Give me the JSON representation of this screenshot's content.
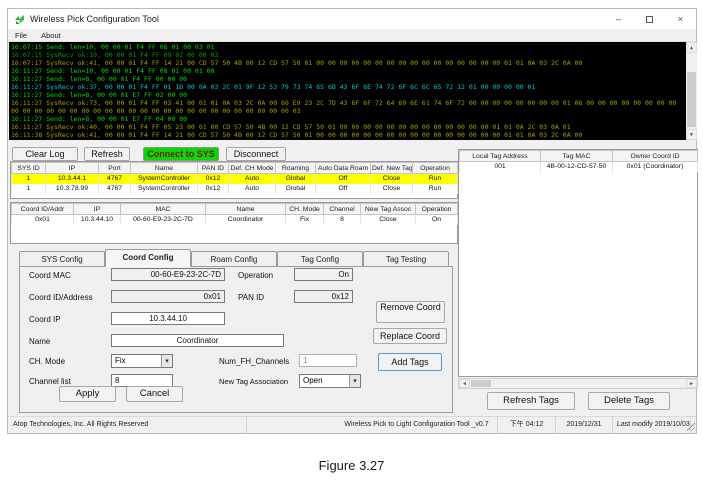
{
  "palette": {
    "log_send_green": "#00dc00",
    "log_recv_green": "#00a000",
    "log_recv_olive": "#a0a000",
    "log_recv_cyan": "#00c8c8",
    "selected_row_yellow": "#ffff00",
    "connect_button_green": "#0ad50a",
    "connect_button_text": "#7a2000"
  },
  "window": {
    "title": "Wireless Pick Configuration Tool",
    "minimize_glyph": "–",
    "close_glyph": "×"
  },
  "menu": {
    "file": "File",
    "about": "About"
  },
  "log": {
    "lines": [
      {
        "color": "g",
        "text": "16:07:15 Send: len=10, 00 00 01 F4 FF 08 01 00 03 01"
      },
      {
        "color": "dg",
        "text": "16:07:15 SysRecv ok:10, 00 00 01 F4 FF 09 02 00 00 03"
      },
      {
        "color": "ol",
        "text": "16:07:17 SysRecv ok:41, 00 00 01 F4 FF 14 21 00 CD 57 50 4B 00 12 CD 57 50 01 00 00 00 00 00 00 00 00 00 00 00 00 00 00 00 00 01 01 0A 03 2C 0A 00"
      },
      {
        "color": "g",
        "text": "16:11:27 Send: len=10, 00 00 01 F4 FF 08 01 00 01 00"
      },
      {
        "color": "g",
        "text": "16:11:27 Send: len=8, 00 00 01 F4 FF 00 00 00"
      },
      {
        "color": "cy",
        "text": "16:11:27 SysRecv ok:37, 00 00 01 F4 FF 01 1D 00 0A 03 2C 01 9F 12 53 79 73 74 65 6D 43 6F 6E 74 72 6F 6C 6C 65 72 12 01 00 00 00 00 01"
      },
      {
        "color": "g",
        "text": "16:11:27 Send: len=8, 00 00 01 E7 FF 02 00 00"
      },
      {
        "color": "ol",
        "text": "16:11:27 SysRecv ok:73, 00 00 01 F4 FF 03 41 00 01 01 0A 03 2C 0A 00 60 E9 23 2C 7D 43 6F 6F 72 64 69 6E 61 74 6F 72 00 00 00 00 00 00 00 00 01 08 00 00 00 00 00 00 00 00 00 00 00 00 00 00 00 00 00 00 00 00 00 00 00 00 00 00 00 00 00 00 00 00 03"
      },
      {
        "color": "g",
        "text": "16:11:27 Send: len=8, 00 00 01 E7 FF 04 00 00"
      },
      {
        "color": "ol",
        "text": "16:11:27 SysRecv ok:40, 00 00 01 F4 FF 05 23 00 01 00 CD 57 50 4B 00 12 CD 57 50 01 00 00 00 00 00 00 00 00 00 00 00 00 00 01 01 0A 2C 03 0A 01"
      },
      {
        "color": "ol",
        "text": "16:11:38 SysRecv ok:41, 00 00 01 F4 FF 14 21 00 CD 57 50 4B 00 12 CD 57 50 01 00 00 00 00 00 00 00 00 00 00 00 00 00 00 00 00 01 01 0A 03 2C 0A 00"
      }
    ]
  },
  "toolbar": {
    "clear_log": "Clear Log",
    "refresh": "Refresh",
    "connect": "Connect to SYS",
    "disconnect": "Disconnect"
  },
  "sys_table": {
    "headers": [
      "SYS ID",
      "IP",
      "Port",
      "Name",
      "PAN ID",
      "Def. CH Mode",
      "Roaming",
      "Auto Data Roam",
      "Def. New Tag",
      "Operation"
    ],
    "rows": [
      [
        "1",
        "10.3.44.1",
        "4767",
        "SystemController",
        "0x12",
        "Auto",
        "Global",
        "Off",
        "Close",
        "Run"
      ],
      [
        "1",
        "10.3.78.99",
        "4767",
        "SystemController",
        "0x12",
        "Auto",
        "Global",
        "Off",
        "Close",
        "Run"
      ]
    ]
  },
  "coord_table": {
    "headers": [
      "Coord ID/Addr",
      "IP",
      "MAC",
      "Name",
      "CH. Mode",
      "Channel",
      "New Tag Assoc",
      "Operation"
    ],
    "rows": [
      [
        "0x01",
        "10.3.44.10",
        "00-60-E9-23-2C-7D",
        "Coordinator",
        "Fix",
        "8",
        "Close",
        "On"
      ]
    ]
  },
  "tabs": {
    "items": [
      "SYS Config",
      "Coord Config",
      "Roam Config",
      "Tag Config",
      "Tag Testing"
    ],
    "active": "Coord Config"
  },
  "coord_form": {
    "coord_mac": {
      "label": "Coord MAC",
      "value": "00-60-E9-23-2C-7D"
    },
    "operation": {
      "label": "Operation",
      "value": "On"
    },
    "coord_id": {
      "label": "Coord ID/Address",
      "value": "0x01"
    },
    "pan_id": {
      "label": "PAN ID",
      "value": "0x12"
    },
    "coord_ip": {
      "label": "Coord IP",
      "value": "10.3.44.10"
    },
    "name": {
      "label": "Name",
      "value": "Coordinator"
    },
    "ch_mode": {
      "label": "CH. Mode",
      "value": "Fix"
    },
    "num_fh": {
      "label": "Num_FH_Channels",
      "value": "1"
    },
    "channel_list": {
      "label": "Channel list",
      "value": "8"
    },
    "new_tag_assoc": {
      "label": "New Tag Association",
      "value": "Open"
    },
    "buttons": {
      "remove": "Remove Coord",
      "replace": "Replace Coord",
      "add_tags": "Add Tags",
      "apply": "Apply",
      "cancel": "Cancel"
    }
  },
  "tag_panel": {
    "headers": [
      "Local Tag Address",
      "Tag MAC",
      "Owner Coord ID"
    ],
    "rows": [
      [
        "001",
        "4B-00-12-CD-57-50",
        "0x01 (Coordinator)"
      ]
    ],
    "refresh_label": "Refresh Tags",
    "delete_label": "Delete Tags"
  },
  "statusbar": {
    "left": "Atop Technologies, Inc. All Rights Reserved",
    "app": "Wireless Pick to Light Configuration Tool _v0.7",
    "time": "下午 04:12",
    "date": "2019/12/31",
    "modified": "Last modify  2019/10/03"
  },
  "caption": "Figure 3.27"
}
